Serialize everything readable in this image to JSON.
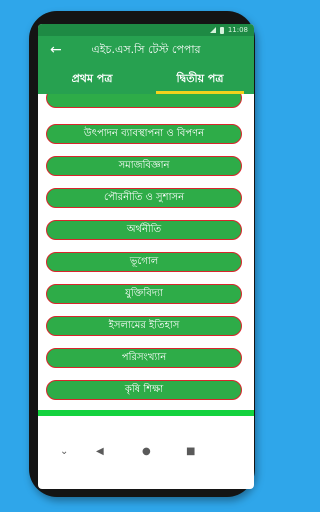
{
  "status": {
    "time": "11:08"
  },
  "header": {
    "back_icon": "arrow-left-icon",
    "title": "এইচ.এস.সি টেস্ট পেপার"
  },
  "tabs": [
    {
      "label": "প্রথম পত্র",
      "active": false
    },
    {
      "label": "দ্বিতীয় পত্র",
      "active": true
    }
  ],
  "subjects": [
    "উৎপাদন ব্যাবস্থাপনা ও বিপণন",
    "সমাজবিজ্ঞান",
    "পৌরনীতি ও সুশাসন",
    "অর্থনীতি",
    "ভূগোল",
    "যুক্তিবিদ্যা",
    "ইসলামের ইতিহাস",
    "পরিসংখ্যান",
    "কৃষি শিক্ষা"
  ],
  "nav": {
    "collapse_icon": "chevron-down-icon",
    "back_icon": "triangle-back-icon",
    "home_icon": "circle-home-icon",
    "recents_icon": "square-recents-icon"
  },
  "colors": {
    "background": "#2fa6ea",
    "appbar": "#27a150",
    "item_fill": "#2eac48",
    "item_border": "#d8262c",
    "tab_indicator": "#f3d21c"
  }
}
